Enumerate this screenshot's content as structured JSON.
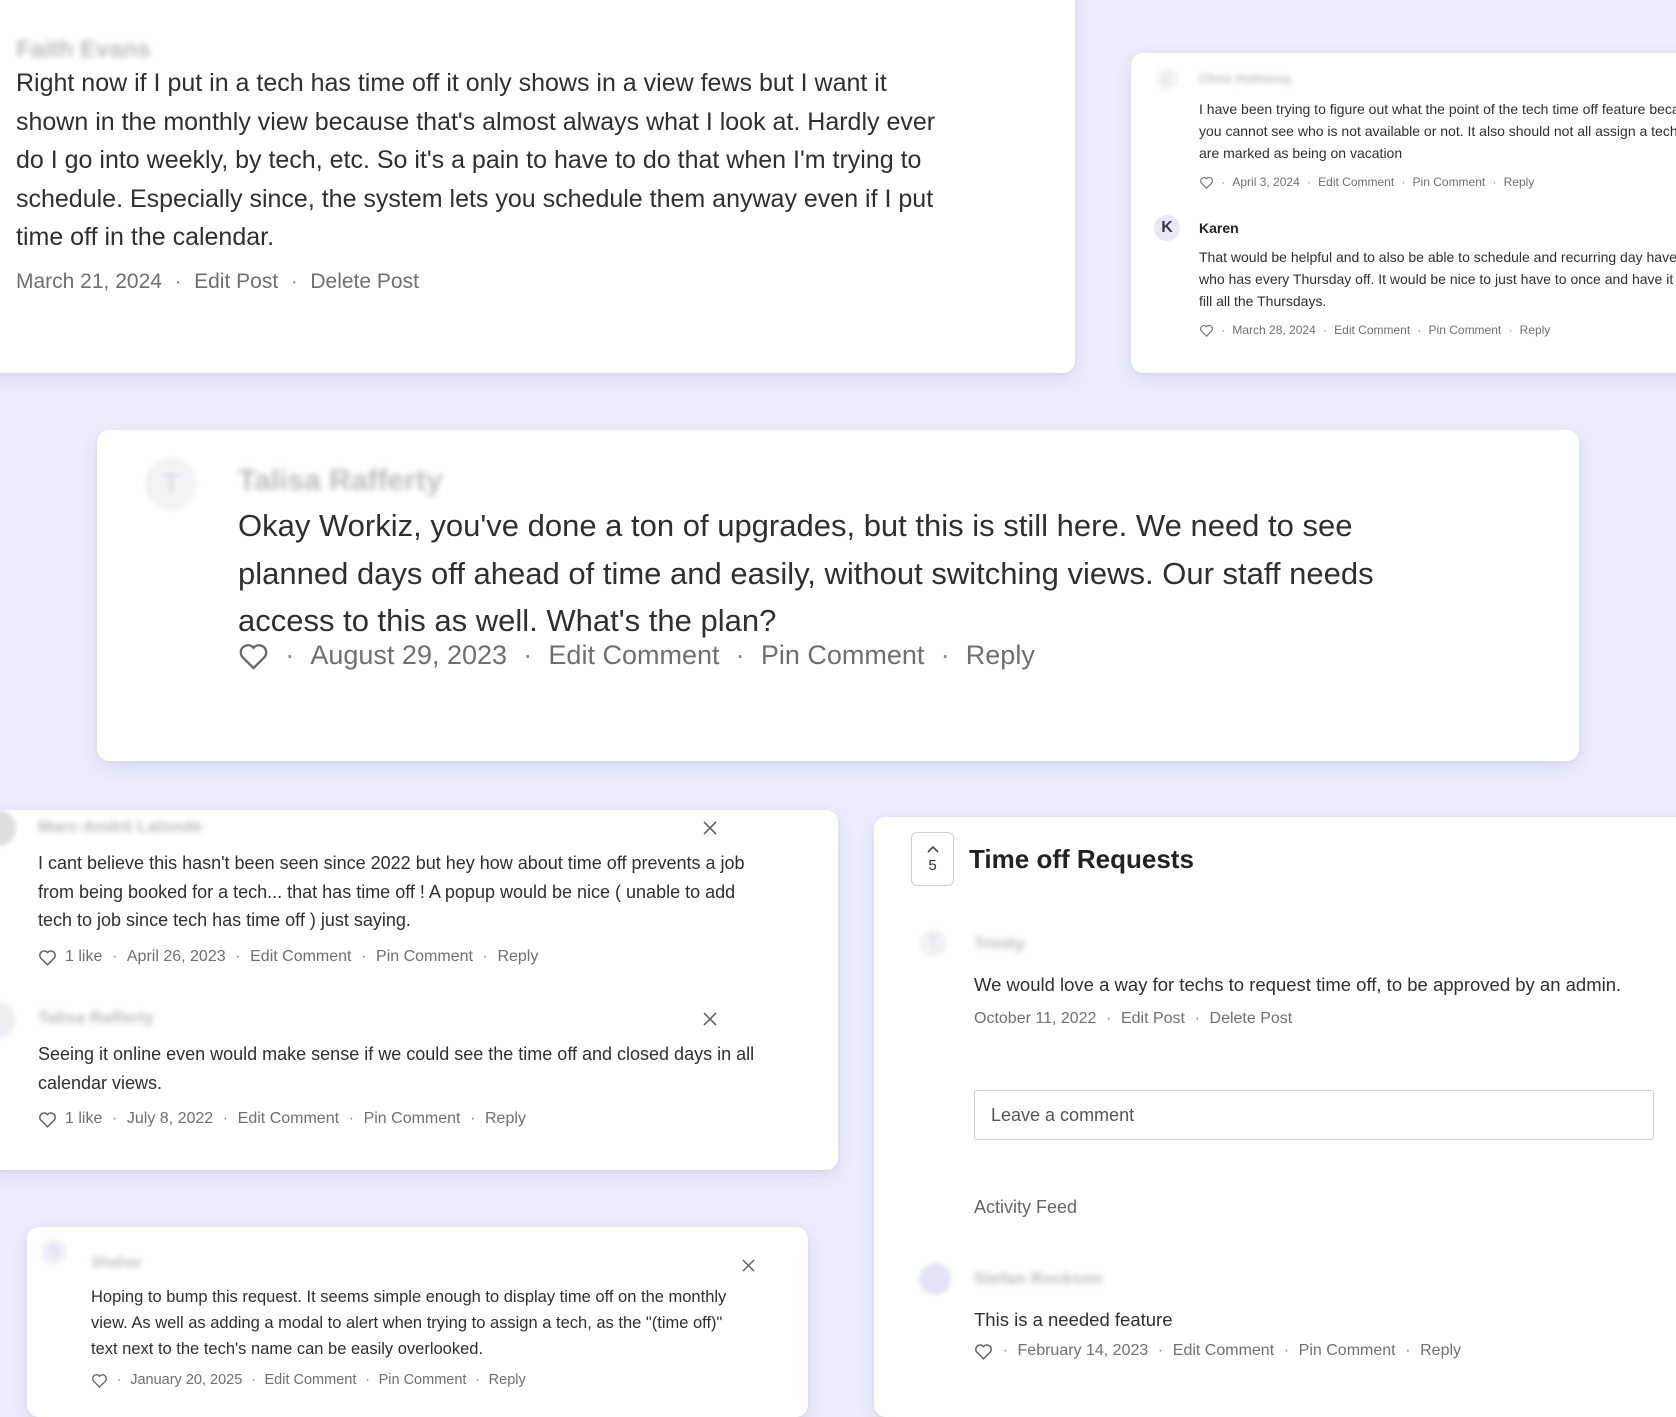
{
  "post_top": {
    "author": "Faith Evans",
    "body": "Right now if I put in a tech has time off it only shows in a view fews but I want it shown in the monthly view because that's almost always what I look at. Hardly ever do I go into weekly, by tech, etc. So it's a pain to have to do that when I'm trying to schedule. Especially since, the system lets you schedule them anyway even if I put time off in the calendar.",
    "date": "March 21, 2024",
    "edit_label": "Edit Post",
    "delete_label": "Delete Post"
  },
  "comments_right_top": [
    {
      "avatar": "C",
      "author": "Chris Holmesq",
      "body": "I have been trying to figure out what the point of the tech time off feature because you cannot see who is not available or not. It also should not all assign a tech if they are marked as being on vacation",
      "date": "April 3, 2024",
      "edit_label": "Edit Comment",
      "pin_label": "Pin Comment",
      "reply_label": "Reply"
    },
    {
      "avatar": "K",
      "author": "Karen",
      "body": "That would be helpful and to also be able to schedule and recurring day have a tech who has every Thursday off. It would be nice to just have to once and have it auto fill all the Thursdays.",
      "date": "March 28, 2024",
      "edit_label": "Edit Comment",
      "pin_label": "Pin Comment",
      "reply_label": "Reply"
    }
  ],
  "comment_center": {
    "avatar": "T",
    "author": "Talisa Rafferty",
    "body": "Okay Workiz, you've done a ton of upgrades, but this is still here. We need to see planned days off ahead of time and easily, without switching views. Our staff needs access to this as well. What's the plan?",
    "date": "August 29, 2023",
    "edit_label": "Edit Comment",
    "pin_label": "Pin Comment",
    "reply_label": "Reply"
  },
  "comments_left": [
    {
      "author": "Marc-André Lalonde",
      "body": "I cant believe this hasn't been seen since 2022 but hey how about time off prevents a job from being booked for a tech... that has time off ! A popup would be nice ( unable to add tech to job since tech has time off ) just saying.",
      "likes": "1 like",
      "date": "April 26, 2023",
      "edit_label": "Edit Comment",
      "pin_label": "Pin Comment",
      "reply_label": "Reply"
    },
    {
      "author": "Talisa Rafferty",
      "body": "Seeing it online even would make sense if we could see the time off and closed days in all calendar views.",
      "likes": "1 like",
      "date": "July 8, 2022",
      "edit_label": "Edit Comment",
      "pin_label": "Pin Comment",
      "reply_label": "Reply"
    }
  ],
  "comment_bottom_left": {
    "avatar": "S",
    "author": "Shahar",
    "body": "Hoping to bump this request. It seems simple enough to display time off on the monthly view. As well as adding a modal to alert when trying to assign a tech, as the \"(time off)\" text next to the tech's name can be easily overlooked.",
    "date": "January 20, 2025",
    "edit_label": "Edit Comment",
    "pin_label": "Pin Comment",
    "reply_label": "Reply"
  },
  "request_panel": {
    "vote_count": "5",
    "title": "Time off Requests",
    "post": {
      "avatar": "T",
      "author": "Trinity",
      "body": "We would love a way for techs to request time off, to be approved by an admin.",
      "date": "October 11, 2022",
      "edit_label": "Edit Post",
      "delete_label": "Delete Post"
    },
    "comment_placeholder": "Leave a comment",
    "activity_label": "Activity Feed",
    "activity_comment": {
      "author": "Stefan Rockson",
      "body": "This is a needed feature",
      "date": "February 14, 2023",
      "edit_label": "Edit Comment",
      "pin_label": "Pin Comment",
      "reply_label": "Reply"
    }
  }
}
